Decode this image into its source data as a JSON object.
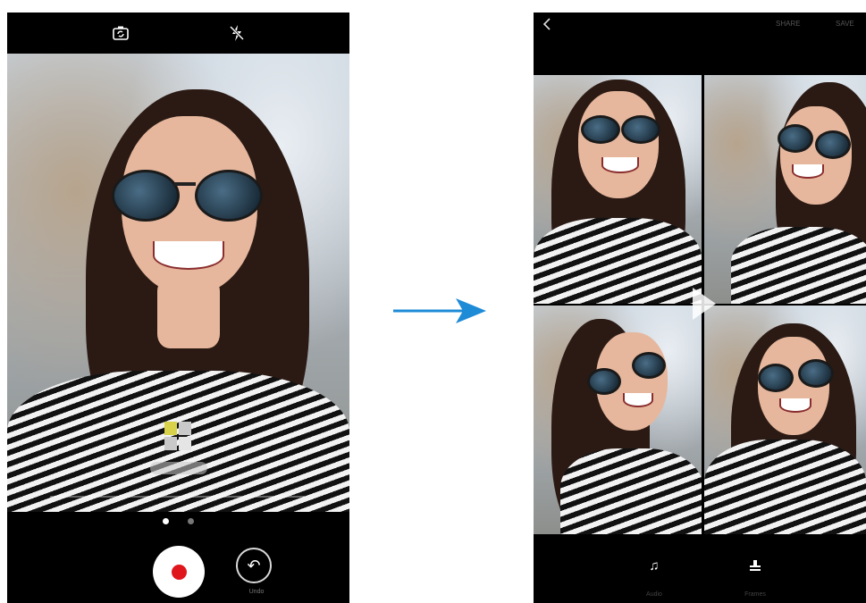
{
  "left_screen": {
    "topbar": {
      "switch_camera_icon": "switch-camera-icon",
      "flash_icon": "flash-off-icon"
    },
    "thumbnail_caption": "",
    "page_indicators": [
      {
        "active": true
      },
      {
        "active": false
      }
    ],
    "bottom": {
      "record_label": "",
      "undo_label": "Undo"
    },
    "colors": {
      "record": "#e0161d",
      "background": "#000000"
    }
  },
  "arrow": {
    "color": "#1e8bd6"
  },
  "right_screen": {
    "topbar": {
      "back_icon": "chevron-left-icon",
      "share_label": "SHARE",
      "save_label": "SAVE"
    },
    "toolbar": {
      "audio_label": "Audio",
      "frames_label": "Frames"
    }
  }
}
